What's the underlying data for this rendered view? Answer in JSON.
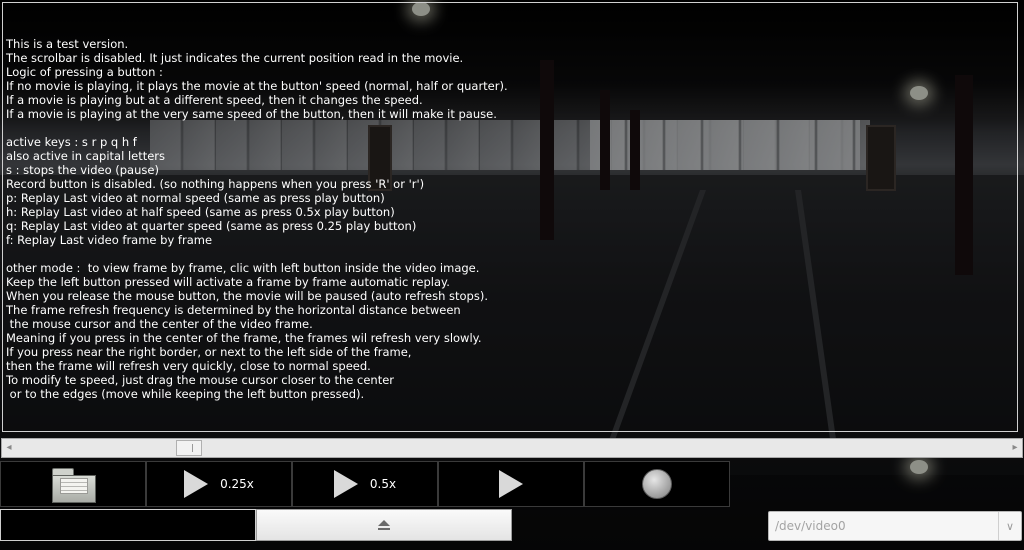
{
  "video": {
    "info_text": "This is a test version.\nThe scrolbar is disabled. It just indicates the current position read in the movie.\nLogic of pressing a button :\nIf no movie is playing, it plays the movie at the button' speed (normal, half or quarter).\nIf a movie is playing but at a different speed, then it changes the speed.\nIf a movie is playing at the very same speed of the button, then it will make it pause.\n\nactive keys : s r p q h f\nalso active in capital letters\ns : stops the video (pause)\nRecord button is disabled. (so nothing happens when you press 'R' or 'r')\np: Replay Last video at normal speed (same as press play button)\nh: Replay Last video at half speed (same as press 0.5x play button)\nq: Replay Last video at quarter speed (same as press 0.25 play button)\nf: Replay Last video frame by frame\n\nother mode :  to view frame by frame, clic with left button inside the video image.\nKeep the left button pressed will activate a frame by frame automatic replay.\nWhen you release the mouse button, the movie will be paused (auto refresh stops).\nThe frame refresh frequency is determined by the horizontal distance between\n the mouse cursor and the center of the video frame.\nMeaning if you press in the center of the frame, the frames wil refresh very slowly.\nIf you press near the right border, or next to the left side of the frame,\nthen the frame will refresh very quickly, close to normal speed.\nTo modify te speed, just drag the mouse cursor closer to the center\n or to the edges (move while keeping the left button pressed)."
  },
  "toolbar": {
    "open_icon": "folder-icon",
    "play_quarter_label": "0.25x",
    "play_half_label": "0.5x",
    "play_icon": "play-icon",
    "record_icon": "record-icon"
  },
  "bottom": {
    "eject_icon": "eject-icon",
    "device_value": "/dev/video0"
  }
}
